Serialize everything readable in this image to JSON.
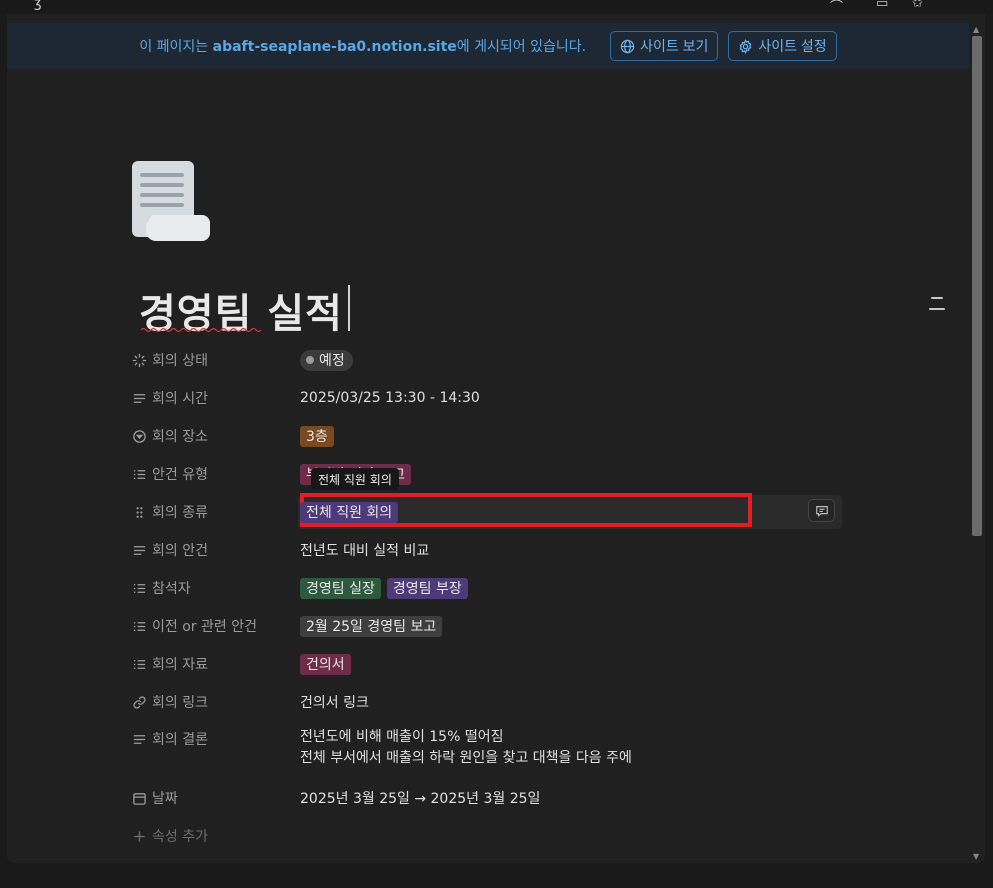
{
  "banner": {
    "prefix": "이 페이지는 ",
    "site": "abaft-seaplane-ba0.notion.site",
    "suffix": "에 게시되어 있습니다.",
    "view_site": "사이트 보기",
    "site_settings": "사이트 설정"
  },
  "page": {
    "title": "경영팀 실적"
  },
  "properties": {
    "status": {
      "label": "회의 상태",
      "value": "예정"
    },
    "time": {
      "label": "회의 시간",
      "value": "2025/03/25 13:30 - 14:30"
    },
    "place": {
      "label": "회의 장소",
      "value": "3층"
    },
    "agenda_type": {
      "label": "안건 유형",
      "value": "부서별 성과 보고"
    },
    "kind": {
      "label": "회의 종류",
      "value": "전체 직원 회의",
      "tooltip": "전체 직원 회의"
    },
    "agenda": {
      "label": "회의 안건",
      "value": "전년도 대비 실적 비교"
    },
    "attendees": {
      "label": "참석자",
      "values": [
        "경영팀 실장",
        "경영팀 부장"
      ]
    },
    "related": {
      "label": "이전 or 관련 안건",
      "value": "2월 25일 경영팀 보고"
    },
    "materials": {
      "label": "회의 자료",
      "value": "건의서"
    },
    "link": {
      "label": "회의 링크",
      "value": "건의서 링크"
    },
    "conclusion": {
      "label": "회의 결론",
      "line1": "전년도에 비해 매출이 15% 떨어짐",
      "line2": "전체 부서에서 매출의 하락 원인을 찾고 대책을 다음 주에"
    },
    "date": {
      "label": "날짜",
      "value": "2025년 3월 25일 → 2025년 3월 25일"
    },
    "add": {
      "label": "속성 추가"
    }
  },
  "colors": {
    "highlight_border": "#e01e24",
    "banner_bg": "#1d2834",
    "accent_blue": "#5aa7e6"
  }
}
